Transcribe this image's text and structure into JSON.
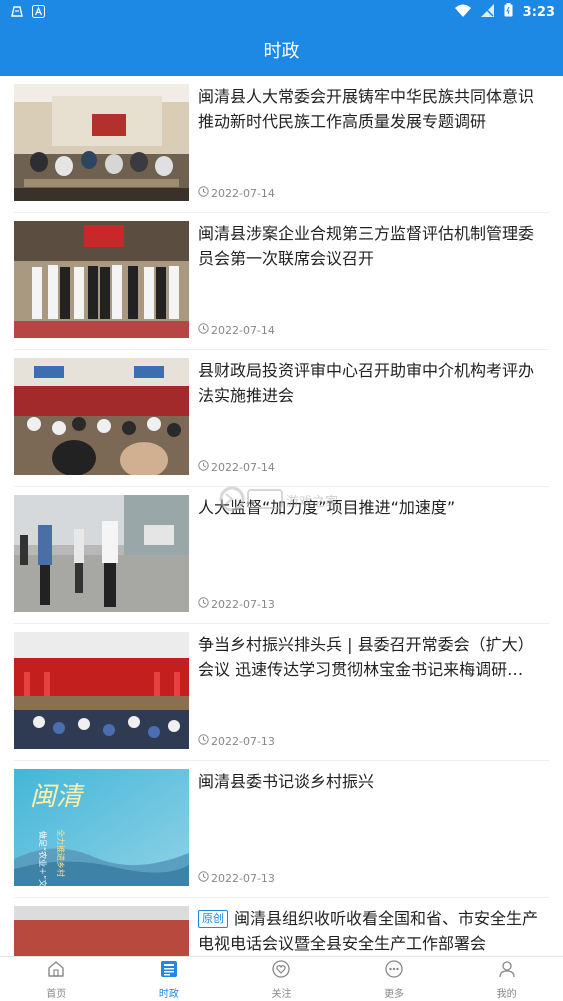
{
  "status_bar": {
    "time": "3:23"
  },
  "header": {
    "title": "时政"
  },
  "news": [
    {
      "title": "闽清县人大常委会开展铸牢中华民族共同体意识推动新时代民族工作高质量发展专题调研",
      "date": "2022-07-14",
      "badge": ""
    },
    {
      "title": "闽清县涉案企业合规第三方监督评估机制管理委员会第一次联席会议召开",
      "date": "2022-07-14",
      "badge": ""
    },
    {
      "title": "县财政局投资评审中心召开助审中介机构考评办法实施推进会",
      "date": "2022-07-14",
      "badge": ""
    },
    {
      "title": "人大监督“加力度”项目推进“加速度”",
      "date": "2022-07-13",
      "badge": ""
    },
    {
      "title": "争当乡村振兴排头兵 | 县委召开常委会（扩大）会议 迅速传达学习贯彻林宝金书记来梅调研…",
      "date": "2022-07-13",
      "badge": ""
    },
    {
      "title": "闽清县委书记谈乡村振兴",
      "date": "2022-07-13",
      "badge": ""
    },
    {
      "title": "闽清县组织收听收看全国和省、市安全生产电视电话会议暨全县安全生产工作部署会",
      "date": "",
      "badge": "原创"
    }
  ],
  "thumb6": {
    "big_text": "闽清",
    "side_text": "做足“农业＋”文",
    "side_text2": "全力推进乡村"
  },
  "watermark": {
    "text": "游戏之家"
  },
  "nav": [
    {
      "label": "首页",
      "icon": "home-icon",
      "active": false
    },
    {
      "label": "时政",
      "icon": "news-icon",
      "active": true
    },
    {
      "label": "关注",
      "icon": "heart-icon",
      "active": false
    },
    {
      "label": "更多",
      "icon": "more-icon",
      "active": false
    },
    {
      "label": "我的",
      "icon": "user-icon",
      "active": false
    }
  ],
  "colors": {
    "primary": "#1e88e5",
    "text": "#222222",
    "muted": "#888888"
  }
}
